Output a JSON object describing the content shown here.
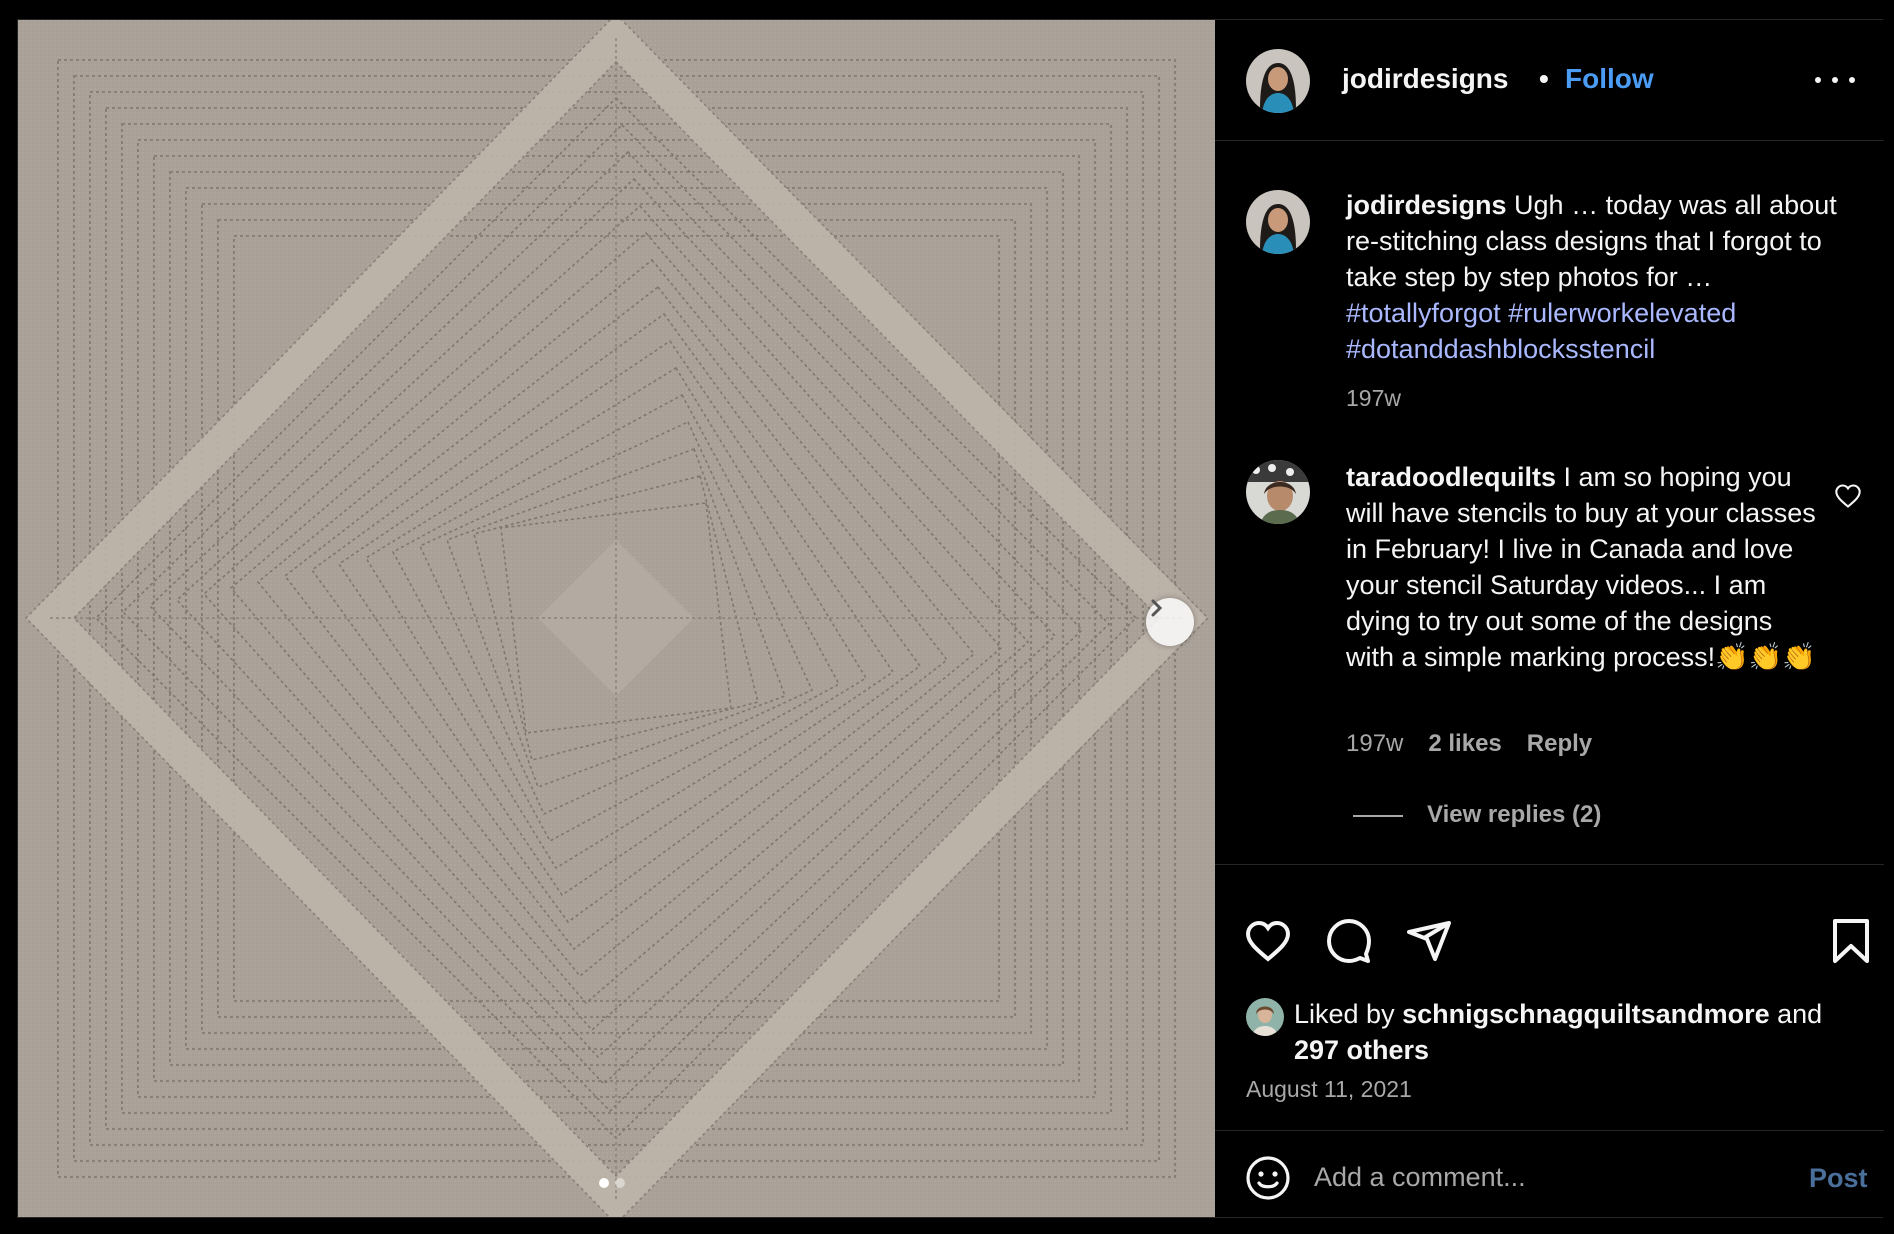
{
  "post": {
    "username": "jodirdesigns",
    "separator": "•",
    "follow_label": "Follow",
    "more_icon": "more-horizontal-icon",
    "image_icon": "quilted-square-pattern",
    "carousel": {
      "current": 1,
      "total": 2
    }
  },
  "caption": {
    "username": "jodirdesigns",
    "text": " Ugh … today was all about re-stitching class designs that I forgot to take step by step photos for … ",
    "hashtags": [
      "#totallyforgot",
      "#rulerworkelevated",
      "#dotanddashblocksstencil"
    ],
    "time": "197w"
  },
  "comment": {
    "username": "taradoodlequilts",
    "text": " I am so hoping you will have stencils to buy at your classes in February! I live in Canada and love your stencil Saturday videos... I am dying to try out some of the designs with a simple marking process!",
    "emoji": "👏👏👏",
    "time": "197w",
    "likes": "2 likes",
    "reply_label": "Reply",
    "view_replies": "View replies (2)"
  },
  "actions": {
    "like_icon": "heart-icon",
    "comment_icon": "comment-icon",
    "share_icon": "send-icon",
    "save_icon": "bookmark-icon"
  },
  "likes": {
    "prefix": "Liked by ",
    "user": "schnigschnagquiltsandmore",
    "middle": " and",
    "others": "297 others"
  },
  "date": "August 11, 2021",
  "add_comment": {
    "placeholder": "Add a comment...",
    "post_label": "Post"
  },
  "colors": {
    "background": "#000000",
    "link_blue": "#4a9cf5",
    "hashtag": "#a9b8ff",
    "muted": "#a8a8a8",
    "post_disabled": "#4a6f9a",
    "fabric": "#a8a097"
  }
}
